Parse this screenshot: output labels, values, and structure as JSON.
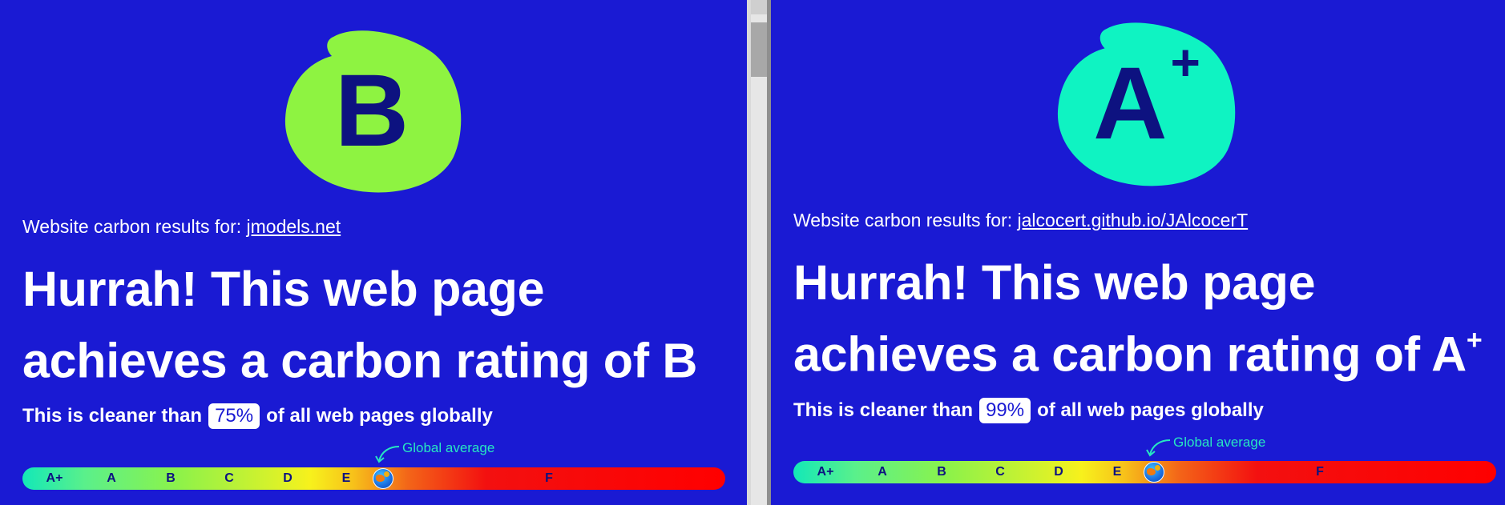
{
  "left": {
    "grade": "B",
    "grade_sup": "",
    "badge_color": "#8ef341",
    "results_prefix": "Website carbon results for:",
    "url": "jmodels.net",
    "headline_line1": "Hurrah! This web page",
    "headline_line2": "achieves a carbon rating of B",
    "headline_sup": "",
    "cleaner_before": "This is cleaner than",
    "percent": "75%",
    "cleaner_after": "of all web pages globally",
    "global_average": "Global average"
  },
  "right": {
    "grade": "A",
    "grade_sup": "+",
    "badge_color": "#0ff3c2",
    "results_prefix": "Website carbon results for:",
    "url": "jalcocert.github.io/JAlcocerT",
    "headline_line1": "Hurrah! This web page",
    "headline_line2": "achieves a carbon rating of A",
    "headline_sup": "+",
    "cleaner_before": "This is cleaner than",
    "percent": "99%",
    "cleaner_after": "of all web pages globally",
    "global_average": "Global average"
  },
  "scale_labels": [
    "A+",
    "A",
    "B",
    "C",
    "D",
    "E",
    "F"
  ],
  "colors": {
    "background": "#1a1ad3",
    "grade_text": "#0d1280",
    "global_average_text": "#27e7c1"
  },
  "icons": {
    "globe": "globe-icon",
    "arrow": "curved-arrow-icon"
  }
}
